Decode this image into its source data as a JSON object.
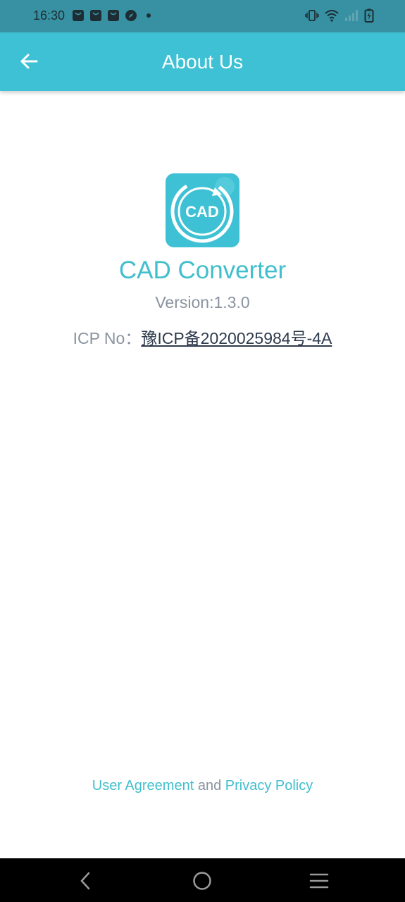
{
  "status_bar": {
    "time": "16:30",
    "notification_icons": [
      "bag-icon",
      "bag-icon",
      "bag-icon",
      "compass-icon"
    ],
    "right_icons": [
      "vibrate-icon",
      "wifi-icon",
      "signal-icon",
      "battery-icon"
    ]
  },
  "app_bar": {
    "title": "About Us",
    "back_icon": "arrow-left-icon",
    "background_color": "#3ec1d4"
  },
  "about": {
    "logo_text": "CAD",
    "app_name": "CAD Converter",
    "version": "Version:1.3.0",
    "icp_label": "ICP No：",
    "icp_number": "豫ICP备2020025984号-4A"
  },
  "footer": {
    "user_agreement": "User Agreement",
    "and": "and",
    "privacy_policy": "Privacy Policy"
  },
  "colors": {
    "accent": "#41bfcc",
    "status_bar": "#3791a2",
    "muted_text": "#8a93a0"
  },
  "nav_bar": {
    "icons": [
      "back-icon",
      "home-icon",
      "menu-icon"
    ]
  }
}
